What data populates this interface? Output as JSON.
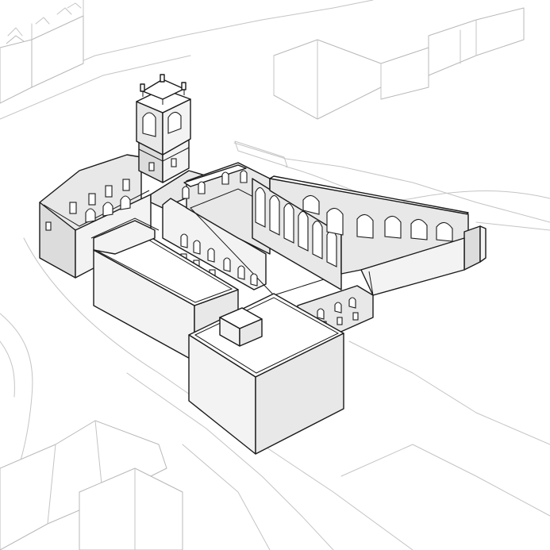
{
  "colors": {
    "background": "#ffffff",
    "line": "#1a1a1a",
    "context_line": "#c4c4c4",
    "wall_shade": "#e8e8e8",
    "roof": "#ffffff"
  }
}
